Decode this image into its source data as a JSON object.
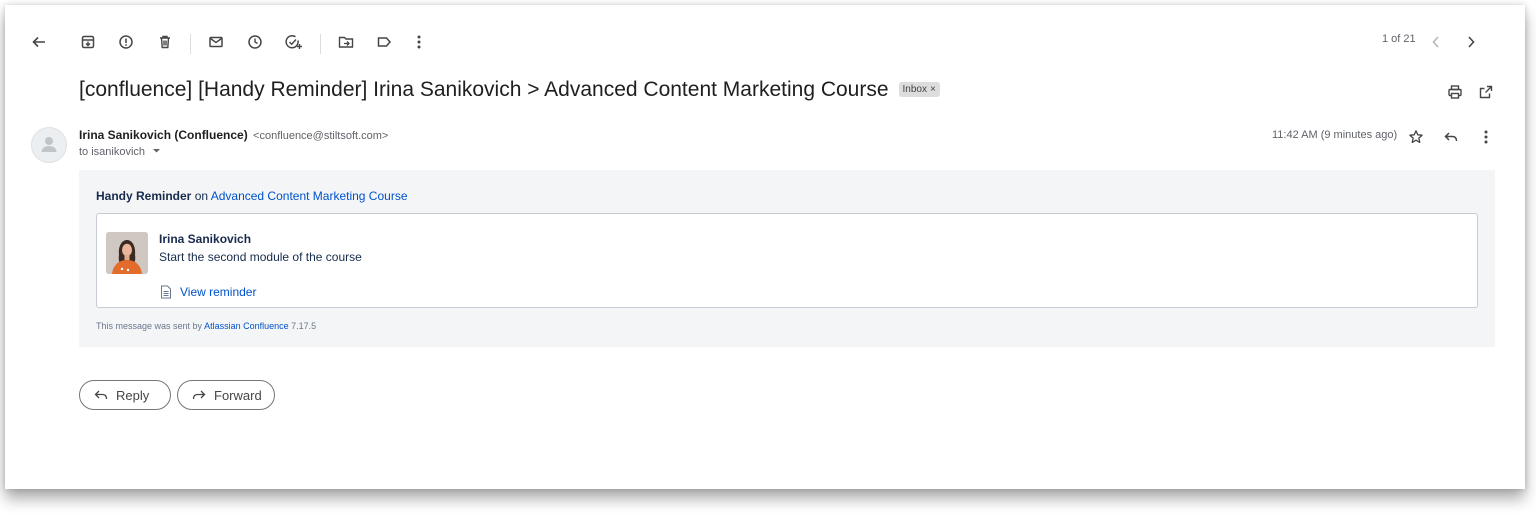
{
  "toolbar": {
    "counter": "1 of 21",
    "icons": [
      "back-arrow-icon",
      "archive-icon",
      "report-spam-icon",
      "delete-icon",
      "mark-unread-icon",
      "snooze-icon",
      "add-task-icon",
      "move-to-icon",
      "label-icon",
      "more-vert-icon",
      "older-chevron-icon",
      "newer-chevron-icon"
    ]
  },
  "subject": {
    "text": "[confluence] [Handy Reminder] Irina Sanikovich > Advanced Content Marketing Course",
    "label_chip": "Inbox",
    "label_chip_close": "×"
  },
  "header_actions": [
    "print-icon",
    "open-in-new-window-icon"
  ],
  "sender": {
    "name": "Irina Sanikovich (Confluence)",
    "email": "<confluence@stiltsoft.com>",
    "to_line": "to isanikovich",
    "timestamp": "11:42 AM (9 minutes ago)"
  },
  "message": {
    "heading_bold": "Handy Reminder",
    "heading_on": " on ",
    "heading_link": "Advanced Content Marketing Course",
    "author": "Irina Sanikovich",
    "body": "Start the second module of the course",
    "view_link": "View reminder",
    "footer_prefix": "This message was sent by ",
    "footer_link": "Atlassian Confluence",
    "footer_version": " 7.17.5"
  },
  "actions": {
    "reply": "Reply",
    "forward": "Forward"
  },
  "colors": {
    "link": "#0052cc",
    "message_background": "#f4f5f7",
    "chip_background": "#dddddd"
  }
}
